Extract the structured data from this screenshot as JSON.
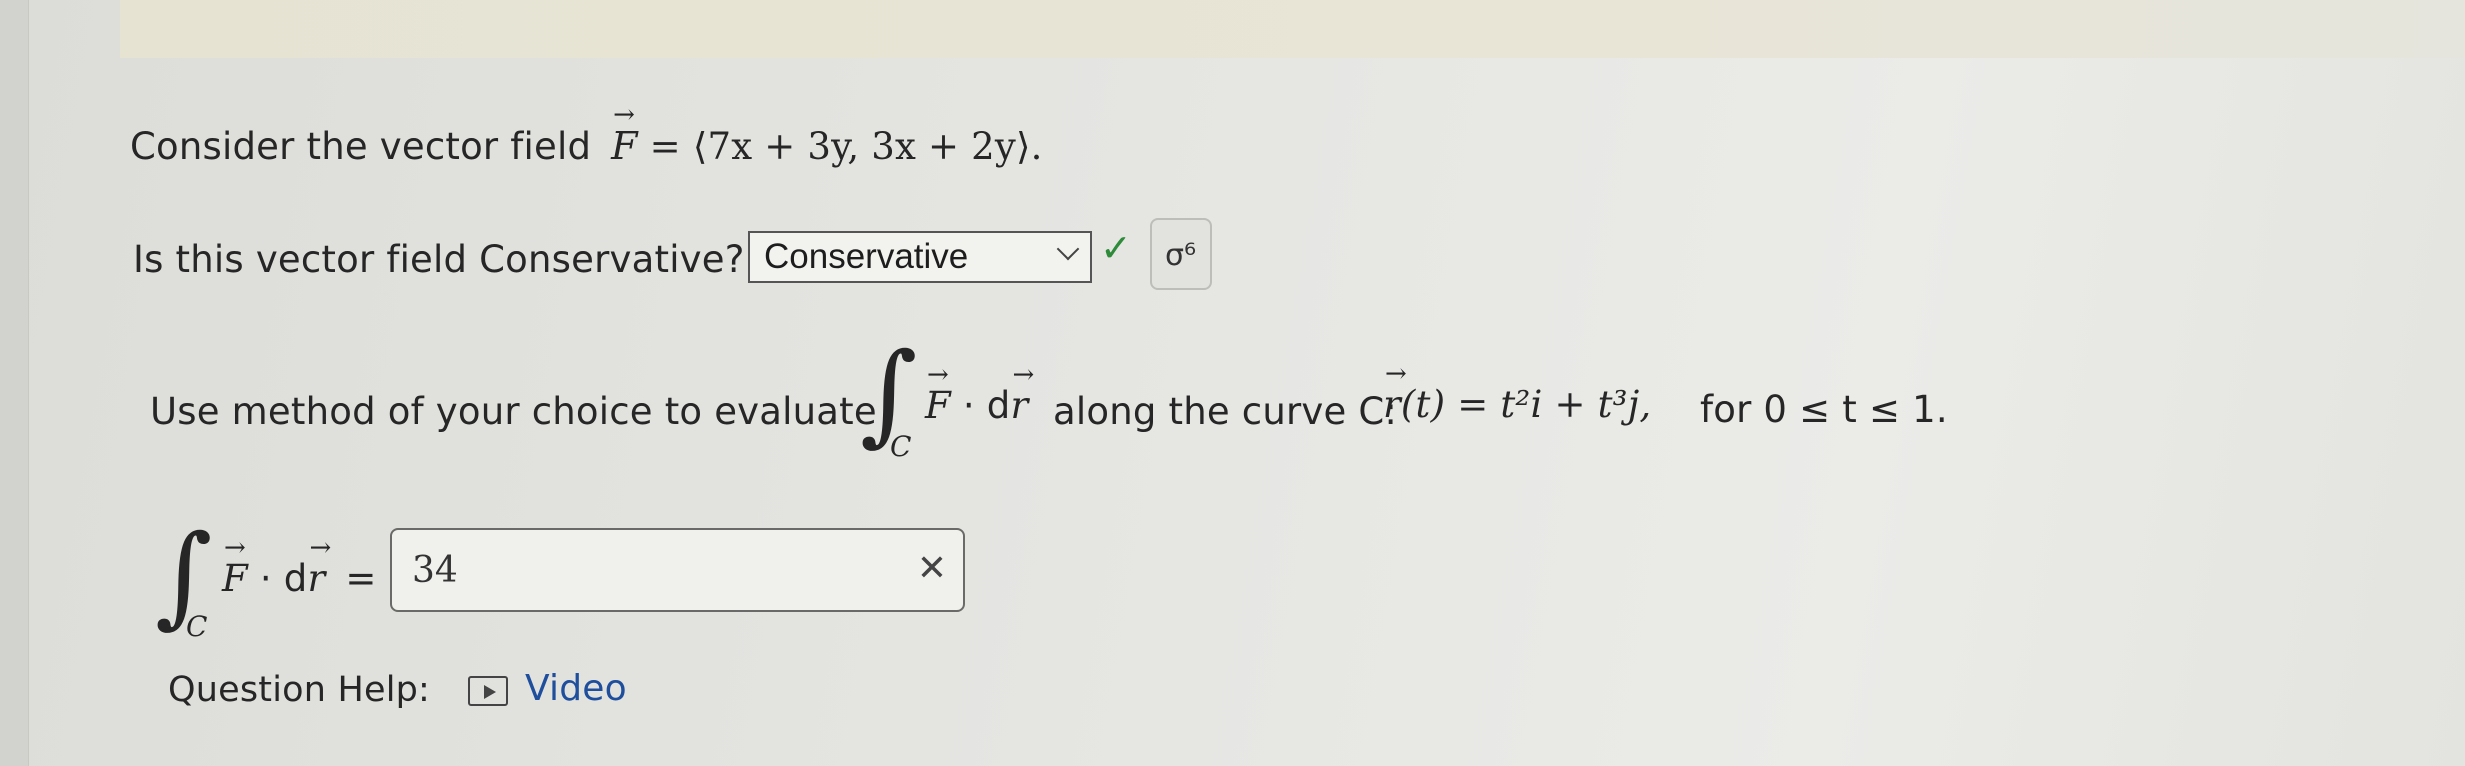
{
  "line1": {
    "prefix": "Consider the vector field",
    "math": "= ⟨7x + 3y, 3x + 2y⟩."
  },
  "line2": {
    "question": "Is this vector field Conservative?",
    "select_value": "Conservative",
    "key_glyph": "σ⁶"
  },
  "line3": {
    "prefix": "Use method of your choice to evaluate",
    "integrand_tail": "· d",
    "middle": "along the curve C:",
    "curve_eq": "(t) = t²i + t³j,",
    "suffix": "for 0 ≤ t ≤ 1."
  },
  "answer": {
    "lhs_tail": "· d",
    "equals": "=",
    "value": "34"
  },
  "help": {
    "label": "Question Help:",
    "video_label": "Video"
  },
  "symbols": {
    "F": "F",
    "r": "r",
    "C": "C",
    "integral": "∫"
  },
  "colors": {
    "check": "#2e8b3a"
  }
}
